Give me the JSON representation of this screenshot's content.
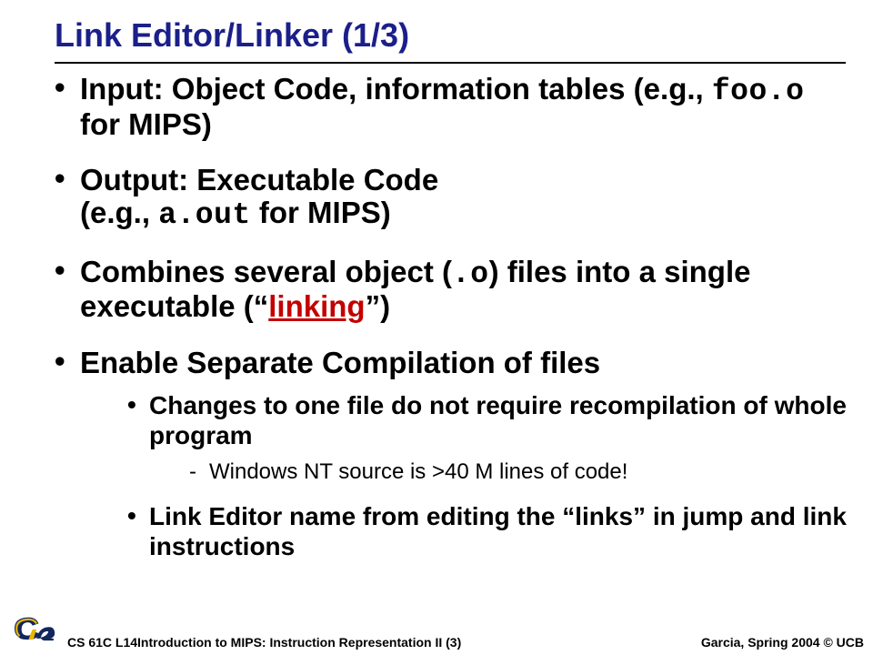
{
  "title": "Link Editor/Linker (1/3)",
  "bullets": {
    "b1_pre": "Input: Object Code, information tables (e.g., ",
    "b1_mono": "foo.o",
    "b1_post": " for MIPS)",
    "b2_pre": "Output: Executable Code",
    "b2_line2_pre": "(e.g., ",
    "b2_mono": "a.out",
    "b2_line2_post": " for MIPS)",
    "b3_pre": "Combines several object (",
    "b3_mono": ".o",
    "b3_mid": ") files into a single executable (“",
    "b3_link": "linking",
    "b3_post": "”)",
    "b4": "Enable Separate Compilation of files",
    "sub1": "Changes to one file do not require recompilation of whole program",
    "dash1": "Windows NT source is >40 M lines of code!",
    "sub2": "Link Editor name from editing the “links” in jump and link instructions"
  },
  "footer": {
    "left": "CS 61C L14Introduction to MIPS: Instruction Representation II (3)",
    "right": "Garcia, Spring 2004 © UCB"
  },
  "logo_alt": "Cal"
}
